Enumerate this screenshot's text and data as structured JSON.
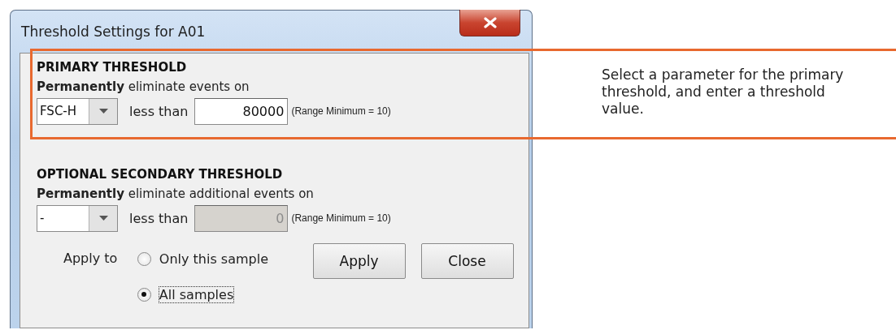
{
  "window": {
    "title": "Threshold Settings for A01"
  },
  "sections": [
    {
      "heading": "PRIMARY THRESHOLD",
      "instruction": "**Permanently** eliminate events on",
      "parameter": "FSC-H",
      "comparison": "less than",
      "value": "80000",
      "disabled": false,
      "range_note": "(Range Minimum = 10)"
    },
    {
      "heading": "OPTIONAL SECONDARY THRESHOLD",
      "instruction": "**Permanently** eliminate additional events on",
      "parameter": "-",
      "comparison": "less than",
      "value": "0",
      "disabled": true,
      "range_note": "(Range Minimum = 10)"
    }
  ],
  "apply_to": {
    "label": "Apply to",
    "options": [
      {
        "label": "Only this sample",
        "selected": false
      },
      {
        "label": "All samples",
        "selected": true
      }
    ]
  },
  "buttons": [
    "Apply",
    "Close"
  ],
  "callout": {
    "text": "Select a parameter for the primary threshold, and enter a threshold value."
  }
}
